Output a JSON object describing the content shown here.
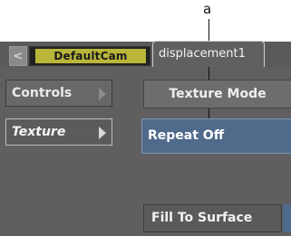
{
  "callout": {
    "label": "a"
  },
  "tabs": {
    "back_glyph": "<",
    "camera_label": "DefaultCam",
    "active_label": "displacement1"
  },
  "sidebar": {
    "items": [
      {
        "label": "Controls",
        "active": false
      },
      {
        "label": "Texture",
        "active": true
      }
    ]
  },
  "texture_mode": {
    "heading": "Texture Mode",
    "selected_value": "Repeat Off",
    "fill_button": "Fill To Surface"
  },
  "colors": {
    "panel": "#5f5f5f",
    "camera_tab": "#b9b63a",
    "selected_blue": "#4f6a8a"
  }
}
